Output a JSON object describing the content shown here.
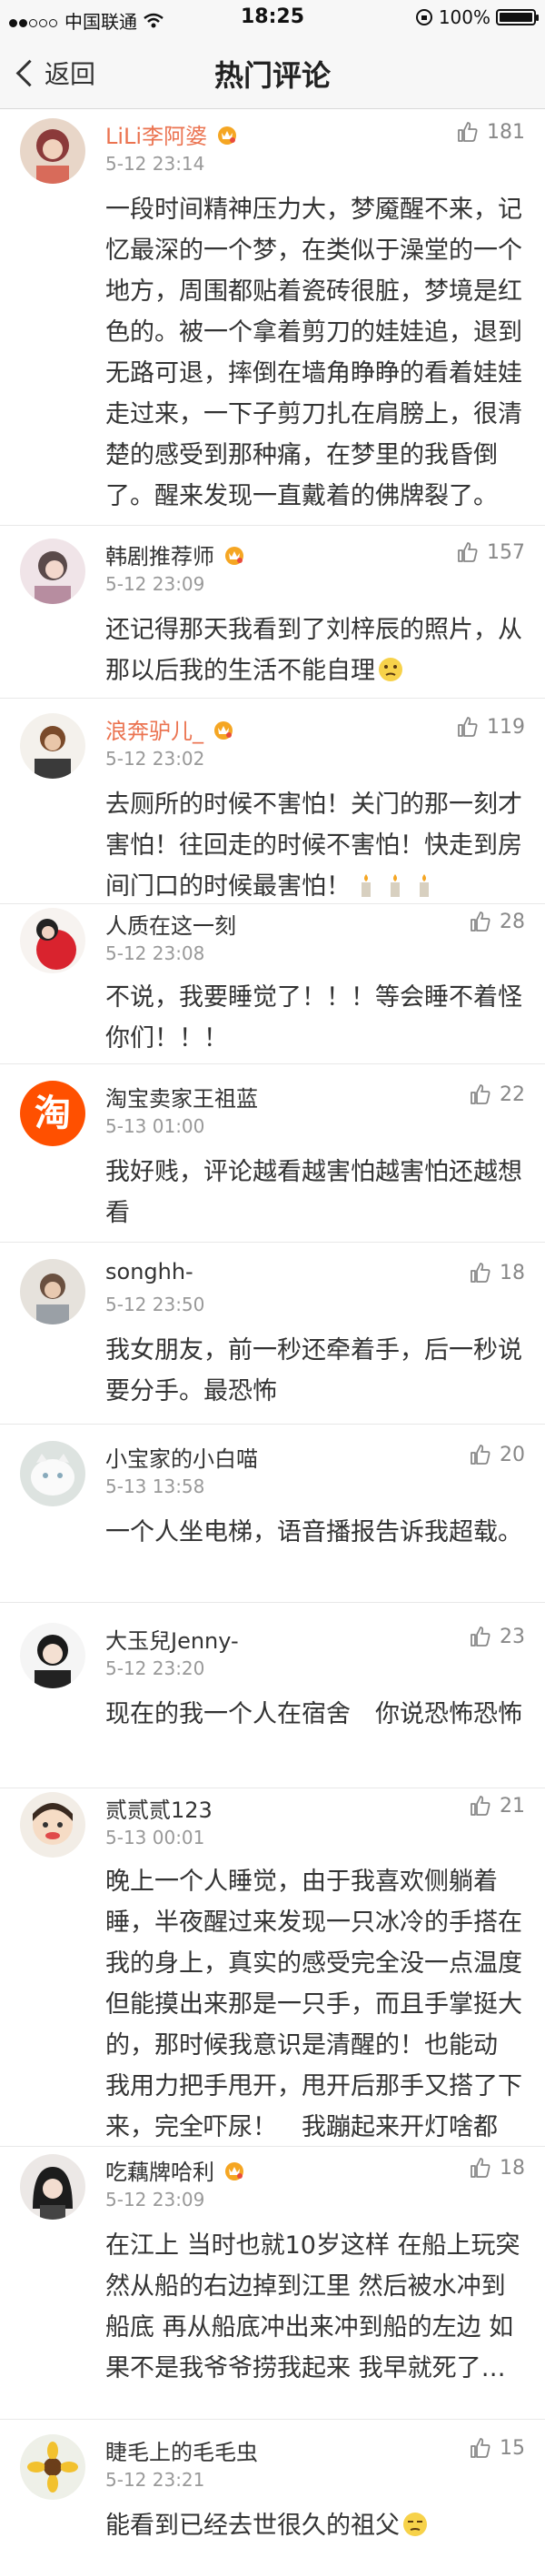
{
  "status": {
    "carrier": "中国联通",
    "time": "18:25",
    "battery": "100%",
    "battery_level": 1.0
  },
  "nav": {
    "back_label": "返回",
    "title": "热门评论"
  },
  "comments": [
    {
      "username": "LiLi李阿婆",
      "time": "5-12 23:14",
      "likes": "181",
      "text": "一段时间精神压力大，梦魇醒不来，记忆最深的一个梦，在类似于澡堂的一个地方，周围都贴着瓷砖很脏，梦境是红色的。被一个拿着剪刀的娃娃追，退到无路可退，摔倒在墙角睁睁的看着娃娃走过来，一下子剪刀扎在肩膀上，很清楚的感受到那种痛，在梦里的我昏倒了。醒来发现一直戴着的佛牌裂了。"
    },
    {
      "username": "韩剧推荐师",
      "time": "5-12 23:09",
      "likes": "157",
      "text": "还记得那天我看到了刘梓辰的照片，从那以后我的生活不能自理"
    },
    {
      "username": "浪奔驴儿_",
      "time": "5-12 23:02",
      "likes": "119",
      "text": "去厕所的时候不害怕！关门的那一刻才害怕！往回走的时候不害怕！快走到房间门口的时候最害怕！"
    },
    {
      "username": "人质在这一刻",
      "time": "5-12 23:08",
      "likes": "28",
      "text": "不说，我要睡觉了！！！等会睡不着怪你们！！！"
    },
    {
      "username": "淘宝卖家王祖蓝",
      "time": "5-13 01:00",
      "likes": "22",
      "text": "我好贱，评论越看越害怕越害怕还越想看",
      "avatar_glyph": "淘"
    },
    {
      "username": "songhh-",
      "time": "5-12 23:50",
      "likes": "18",
      "text": "我女朋友，前一秒还牵着手，后一秒说要分手。最恐怖"
    },
    {
      "username": "小宝家的小白喵",
      "time": "5-13 13:58",
      "likes": "20",
      "text": "一个人坐电梯，语音播报告诉我超载。"
    },
    {
      "username": "大玉兒Jenny-",
      "time": "5-12 23:20",
      "likes": "23",
      "text": "现在的我一个人在宿舍　你说恐怖恐怖"
    },
    {
      "username": "贰贰贰123",
      "time": "5-13 00:01",
      "likes": "21",
      "text": "晚上一个人睡觉，由于我喜欢侧躺着睡，半夜醒过来发现一只冰冷的手搭在我的身上，真实的感受完全没一点温度但能摸出来那是一只手，而且手掌挺大的，那时候我意识是清醒的！也能动 我用力把手甩开，甩开后那手又搭了下来，完全吓尿！　我蹦起来开灯啥都没。"
    },
    {
      "username": "吃藕牌哈利",
      "time": "5-12 23:09",
      "likes": "18",
      "text": "在江上 当时也就10岁这样 在船上玩突然从船的右边掉到江里 然后被水冲到船底 再从船底冲出来冲到船的左边 如果不是我爷爷捞我起来 我早就死了…"
    },
    {
      "username": "睫毛上的毛毛虫",
      "time": "5-12 23:21",
      "likes": "15",
      "text": "能看到已经去世很久的祖父"
    }
  ],
  "colors": {
    "accent_orange": "#eb7350",
    "vip_badge": "#f5a623",
    "text_primary": "#333333",
    "text_secondary": "#999999",
    "taobao_orange": "#ff5000"
  },
  "icons": {
    "like": "thumbs-up-icon",
    "back": "chevron-left-icon",
    "wifi": "wifi-icon",
    "vip": "crown-badge-icon"
  }
}
